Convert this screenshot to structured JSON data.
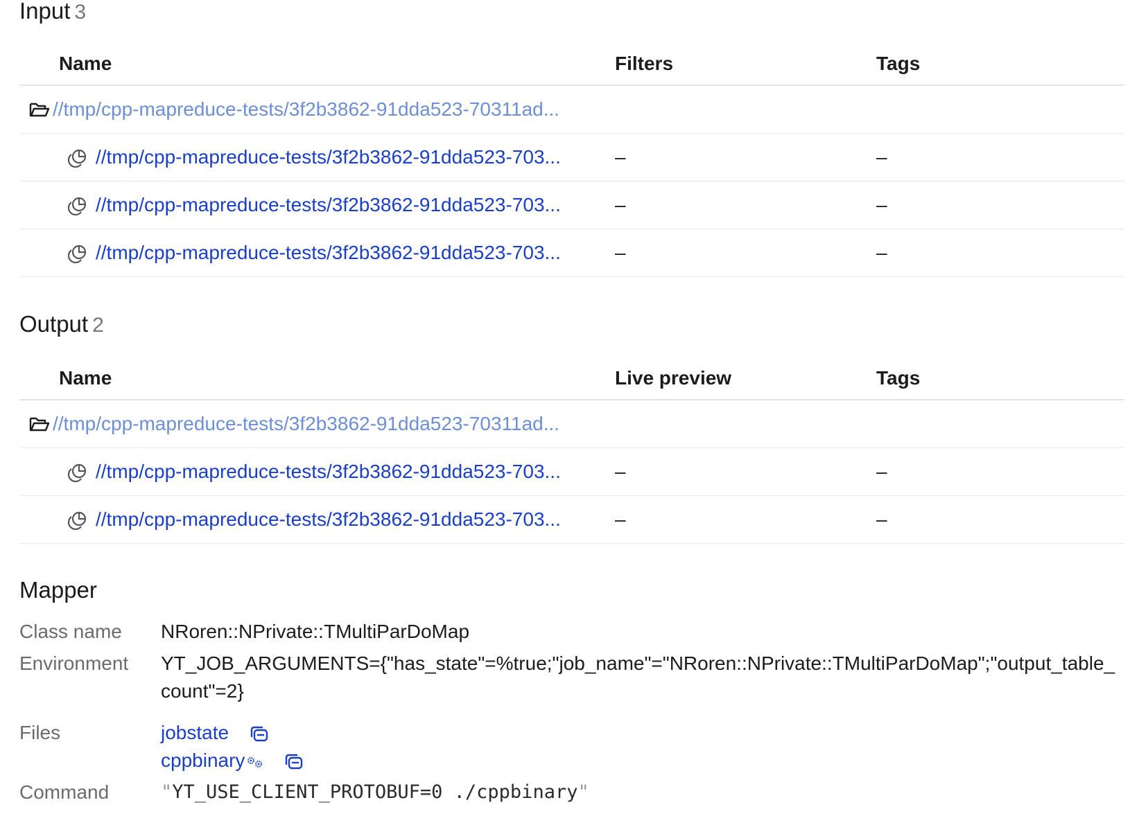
{
  "input": {
    "title": "Input",
    "count": "3",
    "columns": [
      "Name",
      "Filters",
      "Tags"
    ],
    "parent_path": "//tmp/cpp-mapreduce-tests/3f2b3862-91dda523-70311ad...",
    "rows": [
      {
        "path": "//tmp/cpp-mapreduce-tests/3f2b3862-91dda523-703...",
        "filters": "–",
        "tags": "–"
      },
      {
        "path": "//tmp/cpp-mapreduce-tests/3f2b3862-91dda523-703...",
        "filters": "–",
        "tags": "–"
      },
      {
        "path": "//tmp/cpp-mapreduce-tests/3f2b3862-91dda523-703...",
        "filters": "–",
        "tags": "–"
      }
    ]
  },
  "output": {
    "title": "Output",
    "count": "2",
    "columns": [
      "Name",
      "Live preview",
      "Tags"
    ],
    "parent_path": "//tmp/cpp-mapreduce-tests/3f2b3862-91dda523-70311ad...",
    "rows": [
      {
        "path": "//tmp/cpp-mapreduce-tests/3f2b3862-91dda523-703...",
        "live_preview": "–",
        "tags": "–"
      },
      {
        "path": "//tmp/cpp-mapreduce-tests/3f2b3862-91dda523-703...",
        "live_preview": "–",
        "tags": "–"
      }
    ]
  },
  "mapper": {
    "title": "Mapper",
    "class_name_label": "Class name",
    "class_name": "NRoren::NPrivate::TMultiParDoMap",
    "environment_label": "Environment",
    "environment": "YT_JOB_ARGUMENTS={\"has_state\"=%true;\"job_name\"=\"NRoren::NPrivate::TMultiParDoMap\";\"output_table_count\"=2}",
    "files_label": "Files",
    "files": [
      "jobstate",
      "cppbinary"
    ],
    "command_label": "Command",
    "command": "YT_USE_CLIENT_PROTOBUF=0 ./cppbinary"
  },
  "colors": {
    "link": "#1a3fc7",
    "link_parent": "#6d8fd6",
    "label": "#6b6b6b"
  }
}
